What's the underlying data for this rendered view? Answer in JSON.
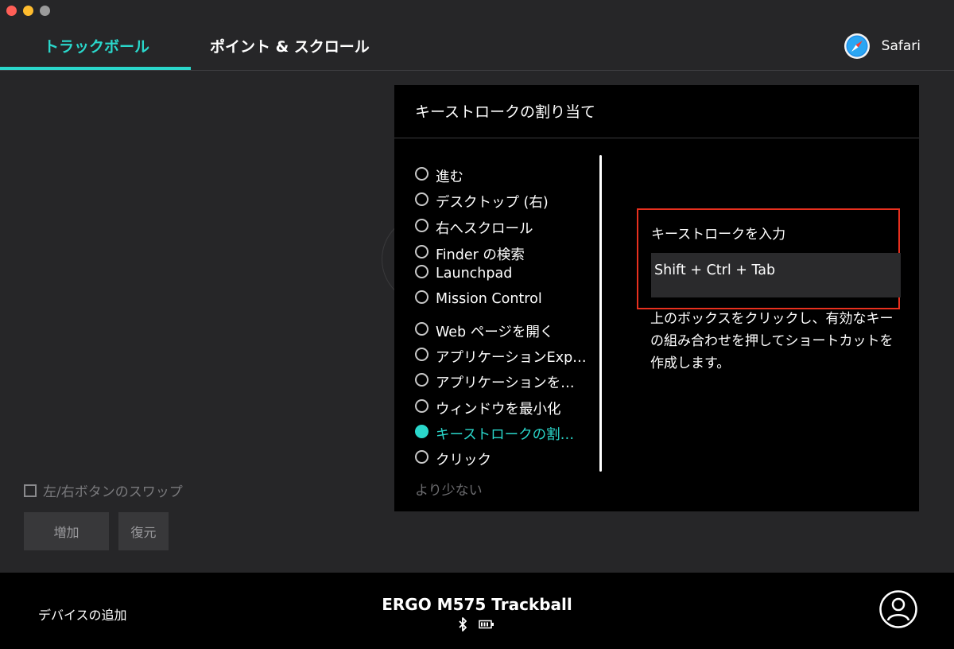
{
  "tabs": [
    {
      "label": "トラックボール",
      "active": true
    },
    {
      "label": "ポイント & スクロール",
      "active": false
    }
  ],
  "app": {
    "label": "Safari",
    "icon": "safari-compass-icon"
  },
  "panel": {
    "title": "キーストロークの割り当て",
    "actions": [
      {
        "label": "進む",
        "selected": false
      },
      {
        "label": "デスクトップ (右)",
        "selected": false
      },
      {
        "label": "右へスクロール",
        "selected": false
      },
      {
        "label": "Finder の検索",
        "selected": false
      },
      {
        "label": "Launchpad",
        "selected": false
      },
      {
        "label": "Mission Control",
        "selected": false
      },
      {
        "label": "Web ページを開く",
        "selected": false
      },
      {
        "label": "アプリケーションExp…",
        "selected": false
      },
      {
        "label": "アプリケーションを…",
        "selected": false
      },
      {
        "label": "ウィンドウを最小化",
        "selected": false
      },
      {
        "label": "キーストロークの割…",
        "selected": true
      },
      {
        "label": "クリック",
        "selected": false
      }
    ],
    "less_label": "より少ない",
    "keystroke_label": "キーストロークを入力",
    "keystroke_value": "Shift + Ctrl + Tab",
    "help_text": "上のボックスをクリックし、有効なキーの組み合わせを押してショートカットを作成します。"
  },
  "swap_label": "左/右ボタンのスワップ",
  "buttons": {
    "add": "増加",
    "restore": "復元"
  },
  "footer": {
    "add_device": "デバイスの追加",
    "device_name": "ERGO M575 Trackball",
    "icons": [
      "bluetooth-icon",
      "battery-icon",
      "profile-icon"
    ]
  },
  "colors": {
    "accent": "#2ad7cb",
    "highlight_border": "#e8301e",
    "background": "#262628",
    "panel": "#000000"
  }
}
